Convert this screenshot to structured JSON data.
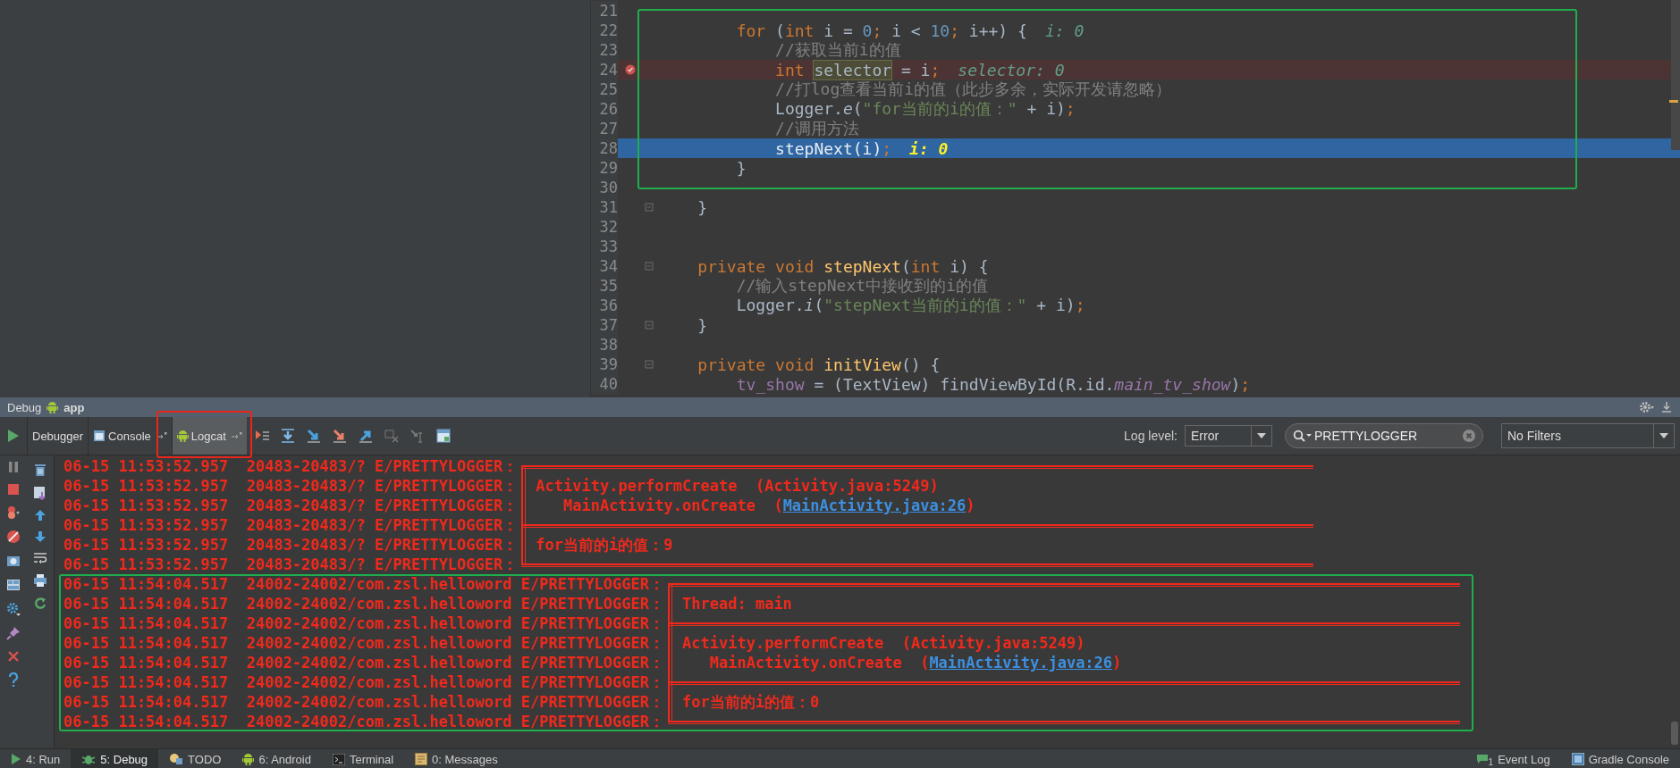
{
  "editor": {
    "lines": [
      {
        "number": "21",
        "breakpoint": false,
        "current": false,
        "fold": false
      },
      {
        "number": "22",
        "breakpoint": false,
        "current": false,
        "fold": false,
        "tokens": [
          {
            "t": "        for",
            "kind": "kw"
          },
          {
            "t": " (",
            "kind": "plain"
          },
          {
            "t": "int",
            "kind": "kw"
          },
          {
            "t": " i = ",
            "kind": "plain"
          },
          {
            "t": "0",
            "kind": "num"
          },
          {
            "t": ";",
            "kind": "kw"
          },
          {
            "t": " i < ",
            "kind": "plain"
          },
          {
            "t": "10",
            "kind": "num"
          },
          {
            "t": ";",
            "kind": "kw"
          },
          {
            "t": " i++) {",
            "kind": "plain"
          }
        ],
        "hint": "i: 0"
      },
      {
        "number": "23",
        "breakpoint": false,
        "current": false,
        "fold": false,
        "tokens": [
          {
            "t": "            //获取当前i的值",
            "kind": "cmt"
          }
        ]
      },
      {
        "number": "24",
        "breakpoint": true,
        "current": false,
        "fold": false,
        "tokens": [
          {
            "t": "            int ",
            "kind": "kw"
          },
          {
            "t": "selector",
            "kind": "sel"
          },
          {
            "t": " = i",
            "kind": "plain"
          },
          {
            "t": ";",
            "kind": "kw"
          }
        ],
        "hint": "selector: 0"
      },
      {
        "number": "25",
        "breakpoint": false,
        "current": false,
        "fold": false,
        "tokens": [
          {
            "t": "            //打log查看当前i的值（此步多余，实际开发请忽略）",
            "kind": "cmt"
          }
        ]
      },
      {
        "number": "26",
        "breakpoint": false,
        "current": false,
        "fold": false,
        "tokens": [
          {
            "t": "            Logger.",
            "kind": "plain"
          },
          {
            "t": "e",
            "kind": "static"
          },
          {
            "t": "(",
            "kind": "plain"
          },
          {
            "t": "\"for当前的i的值：\"",
            "kind": "str"
          },
          {
            "t": " + i)",
            "kind": "plain"
          },
          {
            "t": ";",
            "kind": "kw"
          }
        ]
      },
      {
        "number": "27",
        "breakpoint": false,
        "current": false,
        "fold": false,
        "tokens": [
          {
            "t": "            //调用方法",
            "kind": "cmt"
          }
        ]
      },
      {
        "number": "28",
        "breakpoint": false,
        "current": true,
        "fold": false,
        "tokens": [
          {
            "t": "            stepNext(i)",
            "kind": "plain"
          },
          {
            "t": ";",
            "kind": "kw"
          }
        ],
        "hint": "i: 0"
      },
      {
        "number": "29",
        "breakpoint": false,
        "current": false,
        "fold": false,
        "tokens": [
          {
            "t": "        }",
            "kind": "plain"
          }
        ]
      },
      {
        "number": "30",
        "breakpoint": false,
        "current": false,
        "fold": false
      },
      {
        "number": "31",
        "breakpoint": false,
        "current": false,
        "fold": true,
        "tokens": [
          {
            "t": "    }",
            "kind": "plain"
          }
        ]
      },
      {
        "number": "32",
        "breakpoint": false,
        "current": false,
        "fold": false
      },
      {
        "number": "33",
        "breakpoint": false,
        "current": false,
        "fold": false
      },
      {
        "number": "34",
        "breakpoint": false,
        "current": false,
        "fold": true,
        "tokens": [
          {
            "t": "    private void ",
            "kind": "kw"
          },
          {
            "t": "stepNext",
            "kind": "decl"
          },
          {
            "t": "(",
            "kind": "plain"
          },
          {
            "t": "int",
            "kind": "kw"
          },
          {
            "t": " i) {",
            "kind": "plain"
          }
        ]
      },
      {
        "number": "35",
        "breakpoint": false,
        "current": false,
        "fold": false,
        "tokens": [
          {
            "t": "        //输入stepNext中接收到的i的值",
            "kind": "cmt"
          }
        ]
      },
      {
        "number": "36",
        "breakpoint": false,
        "current": false,
        "fold": false,
        "tokens": [
          {
            "t": "        Logger.",
            "kind": "plain"
          },
          {
            "t": "i",
            "kind": "static"
          },
          {
            "t": "(",
            "kind": "plain"
          },
          {
            "t": "\"stepNext当前的i的值：\"",
            "kind": "str"
          },
          {
            "t": " + i)",
            "kind": "plain"
          },
          {
            "t": ";",
            "kind": "kw"
          }
        ]
      },
      {
        "number": "37",
        "breakpoint": false,
        "current": false,
        "fold": true,
        "tokens": [
          {
            "t": "    }",
            "kind": "plain"
          }
        ]
      },
      {
        "number": "38",
        "breakpoint": false,
        "current": false,
        "fold": false
      },
      {
        "number": "39",
        "breakpoint": false,
        "current": false,
        "fold": true,
        "tokens": [
          {
            "t": "    private void ",
            "kind": "kw"
          },
          {
            "t": "initView",
            "kind": "decl"
          },
          {
            "t": "() {",
            "kind": "plain"
          }
        ]
      },
      {
        "number": "40",
        "breakpoint": false,
        "current": false,
        "fold": false,
        "tokens": [
          {
            "t": "        tv_show",
            "kind": "field"
          },
          {
            "t": " = (TextView) findViewById(R.id.",
            "kind": "plain"
          },
          {
            "t": "main_tv_show",
            "kind": "static-field"
          },
          {
            "t": ")",
            "kind": "plain"
          },
          {
            "t": ";",
            "kind": "kw"
          }
        ]
      }
    ]
  },
  "debug_panel": {
    "title": "Debug",
    "config": "app",
    "tabs": [
      {
        "label": "Debugger",
        "selected": false,
        "pinned": false
      },
      {
        "label": "Console",
        "selected": false,
        "pinned": true
      },
      {
        "label": "Logcat",
        "selected": true,
        "pinned": true
      }
    ],
    "log_level_label": "Log level:",
    "log_level": "Error",
    "search": "PRETTYLOGGER",
    "filter": "No Filters",
    "log": [
      {
        "prefix": "06-15 11:53:52.957  20483-20483/? E/PRETTYLOGGER：",
        "kind": "top"
      },
      {
        "prefix": "06-15 11:53:52.957  20483-20483/? E/PRETTYLOGGER：",
        "kind": "text",
        "text": "Activity.performCreate  (Activity.java:5249)"
      },
      {
        "prefix": "06-15 11:53:52.957  20483-20483/? E/PRETTYLOGGER：",
        "kind": "text",
        "text": "   MainActivity.onCreate  (",
        "link": "MainActivity.java:26",
        "tail": ")"
      },
      {
        "prefix": "06-15 11:53:52.957  20483-20483/? E/PRETTYLOGGER：",
        "kind": "divider"
      },
      {
        "prefix": "06-15 11:53:52.957  20483-20483/? E/PRETTYLOGGER：",
        "kind": "text",
        "text": "for当前的i的值：9"
      },
      {
        "prefix": "06-15 11:53:52.957  20483-20483/? E/PRETTYLOGGER：",
        "kind": "bottom"
      },
      {
        "prefix": "06-15 11:54:04.517  24002-24002/com.zsl.helloword E/PRETTYLOGGER：",
        "kind": "top"
      },
      {
        "prefix": "06-15 11:54:04.517  24002-24002/com.zsl.helloword E/PRETTYLOGGER：",
        "kind": "text",
        "text": "Thread: main"
      },
      {
        "prefix": "06-15 11:54:04.517  24002-24002/com.zsl.helloword E/PRETTYLOGGER：",
        "kind": "divider"
      },
      {
        "prefix": "06-15 11:54:04.517  24002-24002/com.zsl.helloword E/PRETTYLOGGER：",
        "kind": "text",
        "text": "Activity.performCreate  (Activity.java:5249)"
      },
      {
        "prefix": "06-15 11:54:04.517  24002-24002/com.zsl.helloword E/PRETTYLOGGER：",
        "kind": "text",
        "text": "   MainActivity.onCreate  (",
        "link": "MainActivity.java:26",
        "tail": ")"
      },
      {
        "prefix": "06-15 11:54:04.517  24002-24002/com.zsl.helloword E/PRETTYLOGGER：",
        "kind": "divider"
      },
      {
        "prefix": "06-15 11:54:04.517  24002-24002/com.zsl.helloword E/PRETTYLOGGER：",
        "kind": "text",
        "text": "for当前的i的值：0"
      },
      {
        "prefix": "06-15 11:54:04.517  24002-24002/com.zsl.helloword E/PRETTYLOGGER：",
        "kind": "bottom"
      }
    ]
  },
  "status_bar": {
    "tabs": [
      {
        "label": "4: Run",
        "selected": false
      },
      {
        "label": "5: Debug",
        "selected": true
      },
      {
        "label": "TODO",
        "selected": false
      },
      {
        "label": "6: Android",
        "selected": false
      },
      {
        "label": "Terminal",
        "selected": false
      },
      {
        "label": "0: Messages",
        "selected": false
      }
    ],
    "right": [
      {
        "label": "Event Log",
        "badge": "1"
      },
      {
        "label": "Gradle Console"
      }
    ]
  }
}
